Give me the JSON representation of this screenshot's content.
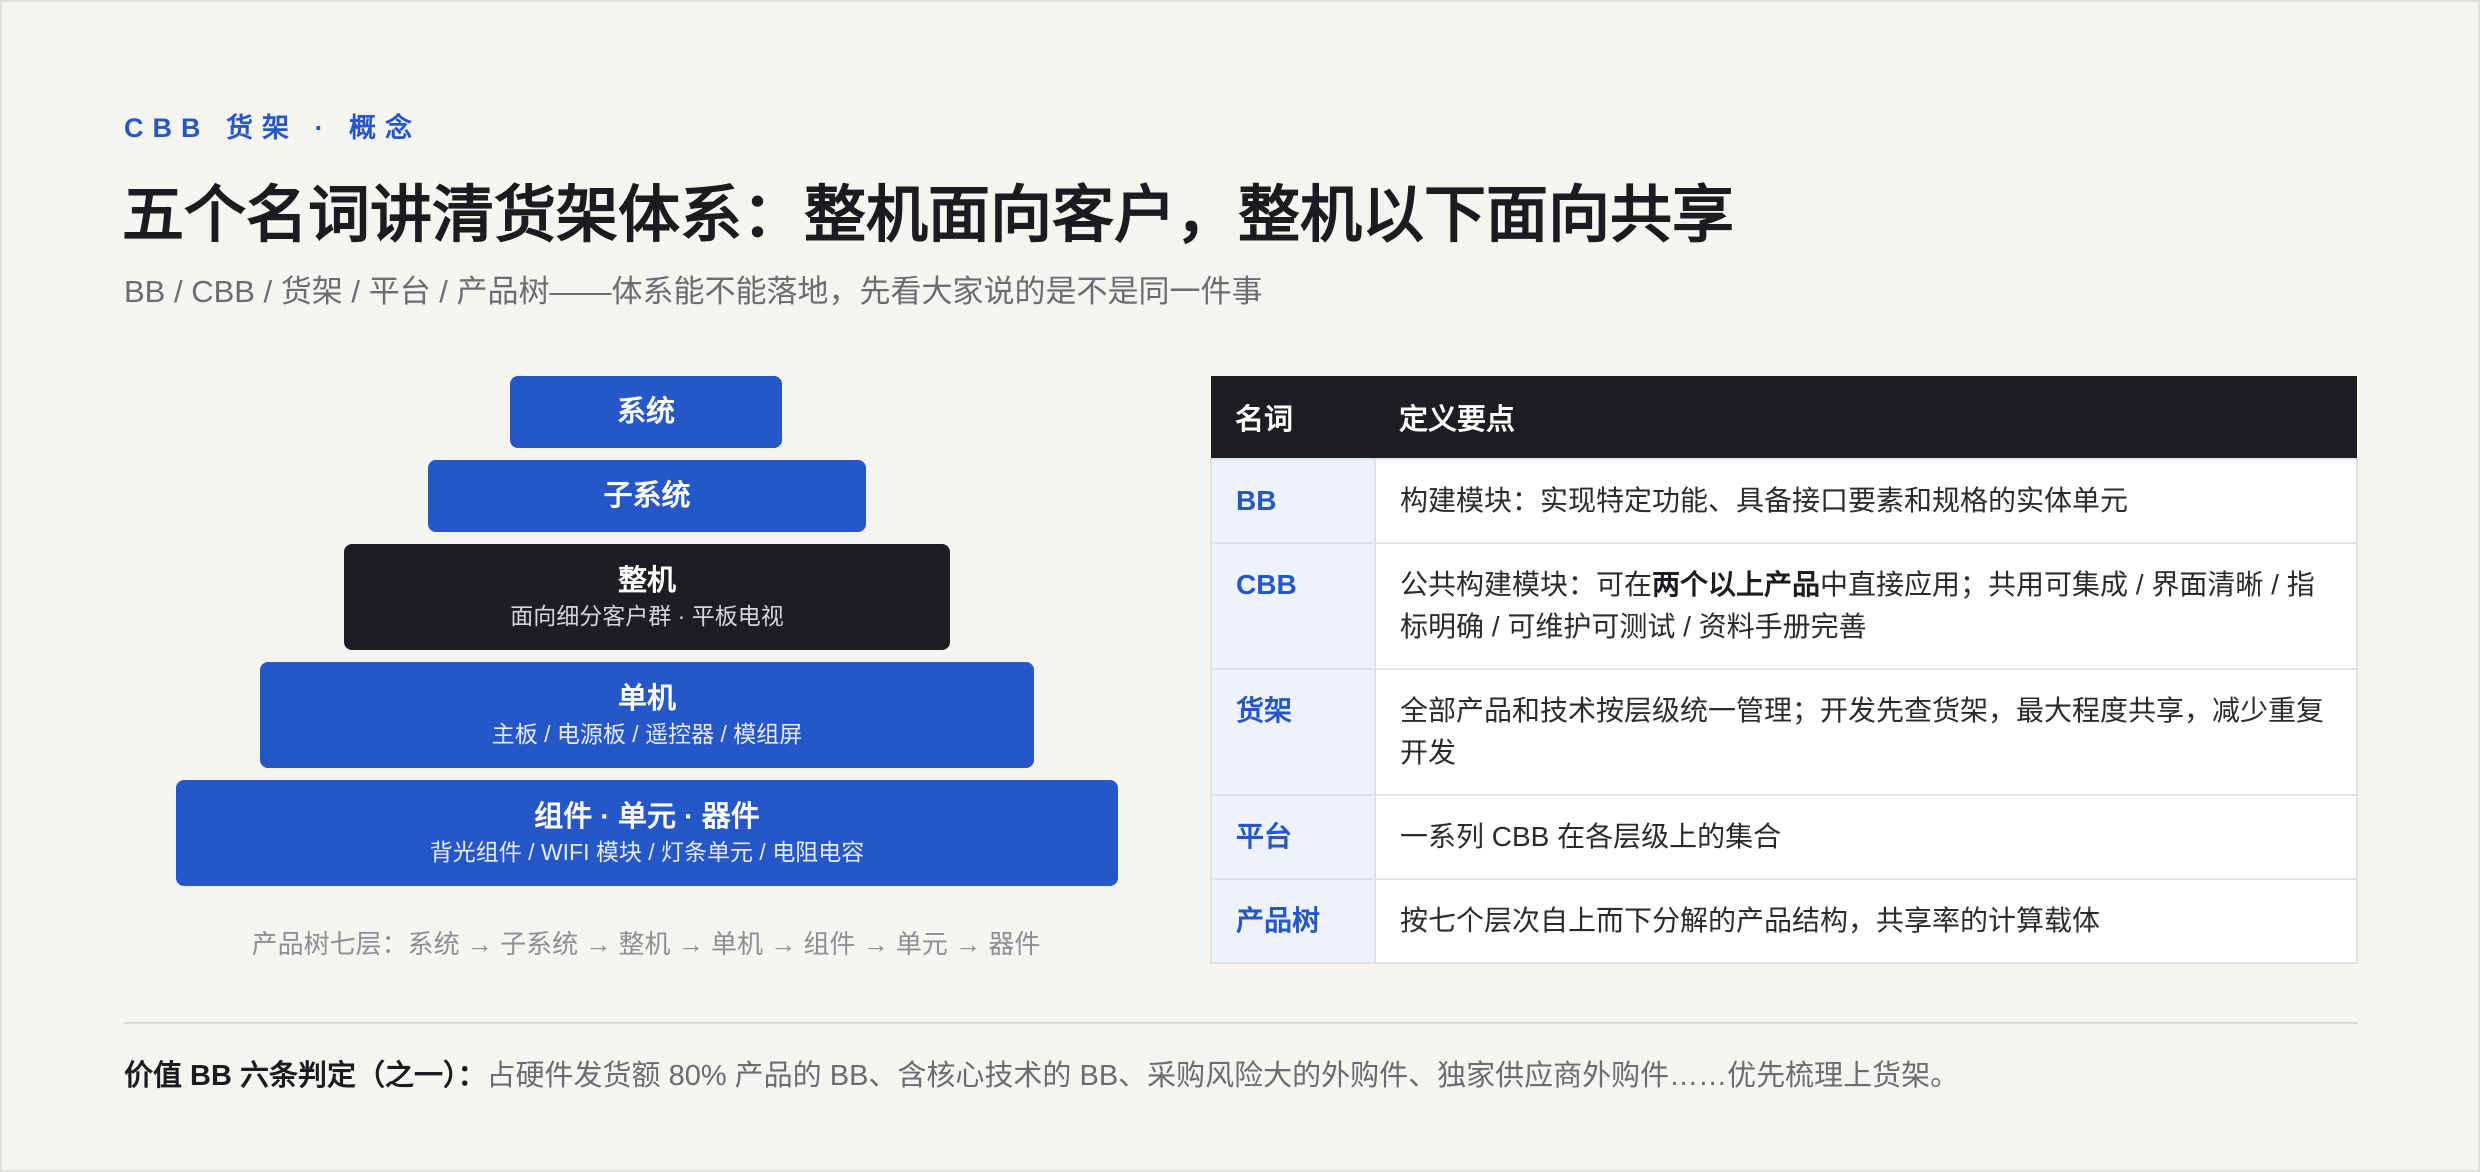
{
  "header": {
    "eyebrow": "CBB 货架 · 概念",
    "title": "五个名词讲清货架体系：整机面向客户，整机以下面向共享",
    "subtitle": "BB / CBB / 货架 / 平台 / 产品树——体系能不能落地，先看大家说的是不是同一件事"
  },
  "pyramid": {
    "tiers": [
      {
        "name": "系统",
        "desc": ""
      },
      {
        "name": "子系统",
        "desc": ""
      },
      {
        "name": "整机",
        "desc": "面向细分客户群 · 平板电视"
      },
      {
        "name": "单机",
        "desc": "主板 / 电源板 / 遥控器 / 模组屏"
      },
      {
        "name": "组件 · 单元 · 器件",
        "desc": "背光组件 / WIFI 模块 / 灯条单元 / 电阻电容"
      }
    ],
    "caption": "产品树七层：系统 → 子系统 → 整机 → 单机 → 组件 → 单元 → 器件"
  },
  "table": {
    "headers": [
      "名词",
      "定义要点"
    ],
    "rows": [
      {
        "term": "BB",
        "def_pre": "构建模块：实现特定功能、具备接口要素和规格的实体单元",
        "def_bold": "",
        "def_post": ""
      },
      {
        "term": "CBB",
        "def_pre": "公共构建模块：可在",
        "def_bold": "两个以上产品",
        "def_post": "中直接应用；共用可集成 / 界面清晰 / 指标明确 / 可维护可测试 / 资料手册完善"
      },
      {
        "term": "货架",
        "def_pre": "全部产品和技术按层级统一管理；开发先查货架，最大程度共享，减少重复开发",
        "def_bold": "",
        "def_post": ""
      },
      {
        "term": "平台",
        "def_pre": "一系列 CBB 在各层级上的集合",
        "def_bold": "",
        "def_post": ""
      },
      {
        "term": "产品树",
        "def_pre": "按七个层次自上而下分解的产品结构，共享率的计算载体",
        "def_bold": "",
        "def_post": ""
      }
    ]
  },
  "footer": {
    "lead": "价值 BB 六条判定（之一）：",
    "text": "占硬件发货额 80% 产品的 BB、含核心技术的 BB、采购风险大的外购件、独家供应商外购件……优先梳理上货架。"
  },
  "colors": {
    "accent": "#2557c8",
    "dark": "#1d1e22",
    "background": "#f5f4f0",
    "term_cell": "#eef2fb"
  }
}
